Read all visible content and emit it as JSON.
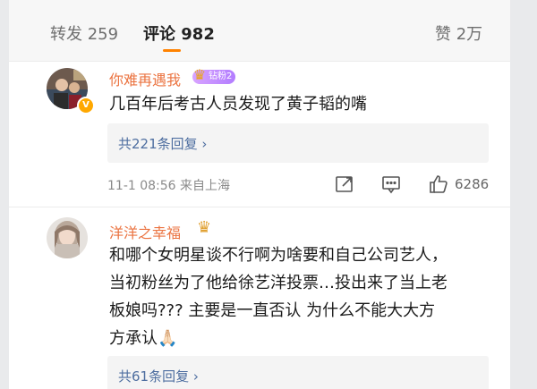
{
  "tabs": {
    "repost": "转发 259",
    "comments": "评论 982",
    "likes": "赞 2万"
  },
  "comments": [
    {
      "username": "你难再遇我",
      "fan_badge": "钻粉2",
      "text": "几百年后考古人员发现了黄子韬的嘴",
      "replies_link": "共221条回复 ›",
      "timestamp": "11-1 08:56 来自上海",
      "like_count": "6286"
    },
    {
      "username": "洋洋之幸福",
      "text_lines": [
        "和哪个女明星谈不行啊为啥要和自己公司艺人，",
        "当初粉丝为了他给徐艺洋投票…投出来了当上老",
        "板娘吗??? 主要是一直否认 为什么不能大大方",
        "方承认🙏🏻"
      ],
      "replies_link": "共61条回复 ›"
    }
  ],
  "colors": {
    "username": "#eb7340",
    "accent": "#ff8200",
    "reply_link": "#4e6ea0"
  },
  "icons": [
    "repost-icon",
    "comment-icon",
    "like-icon",
    "vip-badge-icon",
    "crown-icon"
  ]
}
